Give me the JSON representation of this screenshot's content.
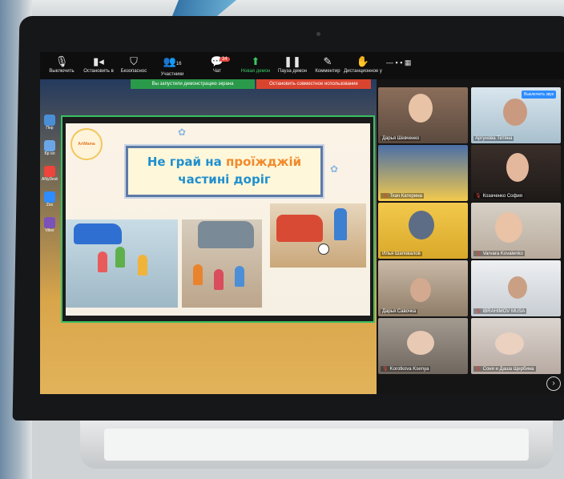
{
  "zoom_toolbar": {
    "items": [
      {
        "label": "Выключить",
        "icon": "microphone-icon"
      },
      {
        "label": "Остановить в",
        "icon": "video-camera-icon"
      },
      {
        "label": "Безопаснос",
        "icon": "shield-icon"
      },
      {
        "label": "Участники",
        "icon": "participants-icon",
        "count": "16"
      },
      {
        "label": "Чат",
        "icon": "chat-icon",
        "badge": "34"
      },
      {
        "label": "Новая демон",
        "icon": "share-screen-icon"
      },
      {
        "label": "Пауза демон",
        "icon": "pause-icon"
      },
      {
        "label": "Комментир",
        "icon": "annotate-pen-icon"
      },
      {
        "label": "Дистанционное у",
        "icon": "remote-control-icon"
      }
    ],
    "share_notice": "Вы запустили демонстрацию экрана",
    "stop_share": "Остановить совместное использование",
    "accent_green": "#3cc864",
    "stop_red": "#d9442f"
  },
  "slide": {
    "logo": "ArtMama",
    "title_line1_part1": "Не грай на",
    "title_line1_part2": "проїжджій",
    "title_line2": "частині доріг",
    "colors": {
      "title_blue": "#1f8fcf",
      "title_orange": "#f08a2c"
    }
  },
  "desktop": {
    "icons": [
      {
        "label": "Пер",
        "icon": "folder-icon"
      },
      {
        "label": "Бр ол",
        "icon": "folder-icon"
      },
      {
        "label": "ANyDesk",
        "icon": "anydesk-icon"
      },
      {
        "label": "Zoo",
        "icon": "zoom-app-icon"
      },
      {
        "label": "Viber",
        "icon": "viber-icon"
      }
    ]
  },
  "gallery": {
    "tiles": [
      {
        "name": "Дарья Шевченко",
        "muted": false
      },
      {
        "name": "Аргунова Тетяна",
        "muted": false
      },
      {
        "name": "Ткач Катерина",
        "muted": true
      },
      {
        "name": "Козаченко София",
        "muted": true
      },
      {
        "name": "Илья Шаповалов",
        "muted": false
      },
      {
        "name": "Varvara Kovalenko",
        "muted": true
      },
      {
        "name": "Дарья Савочка",
        "muted": false
      },
      {
        "name": "IBRAHIMOV MUSA",
        "muted": true
      },
      {
        "name": "Korotkova Ksenya",
        "muted": true
      },
      {
        "name": "Соня и Даша Щербина",
        "muted": true
      }
    ],
    "hover_button": "Выключить звук",
    "next_label": "›"
  }
}
